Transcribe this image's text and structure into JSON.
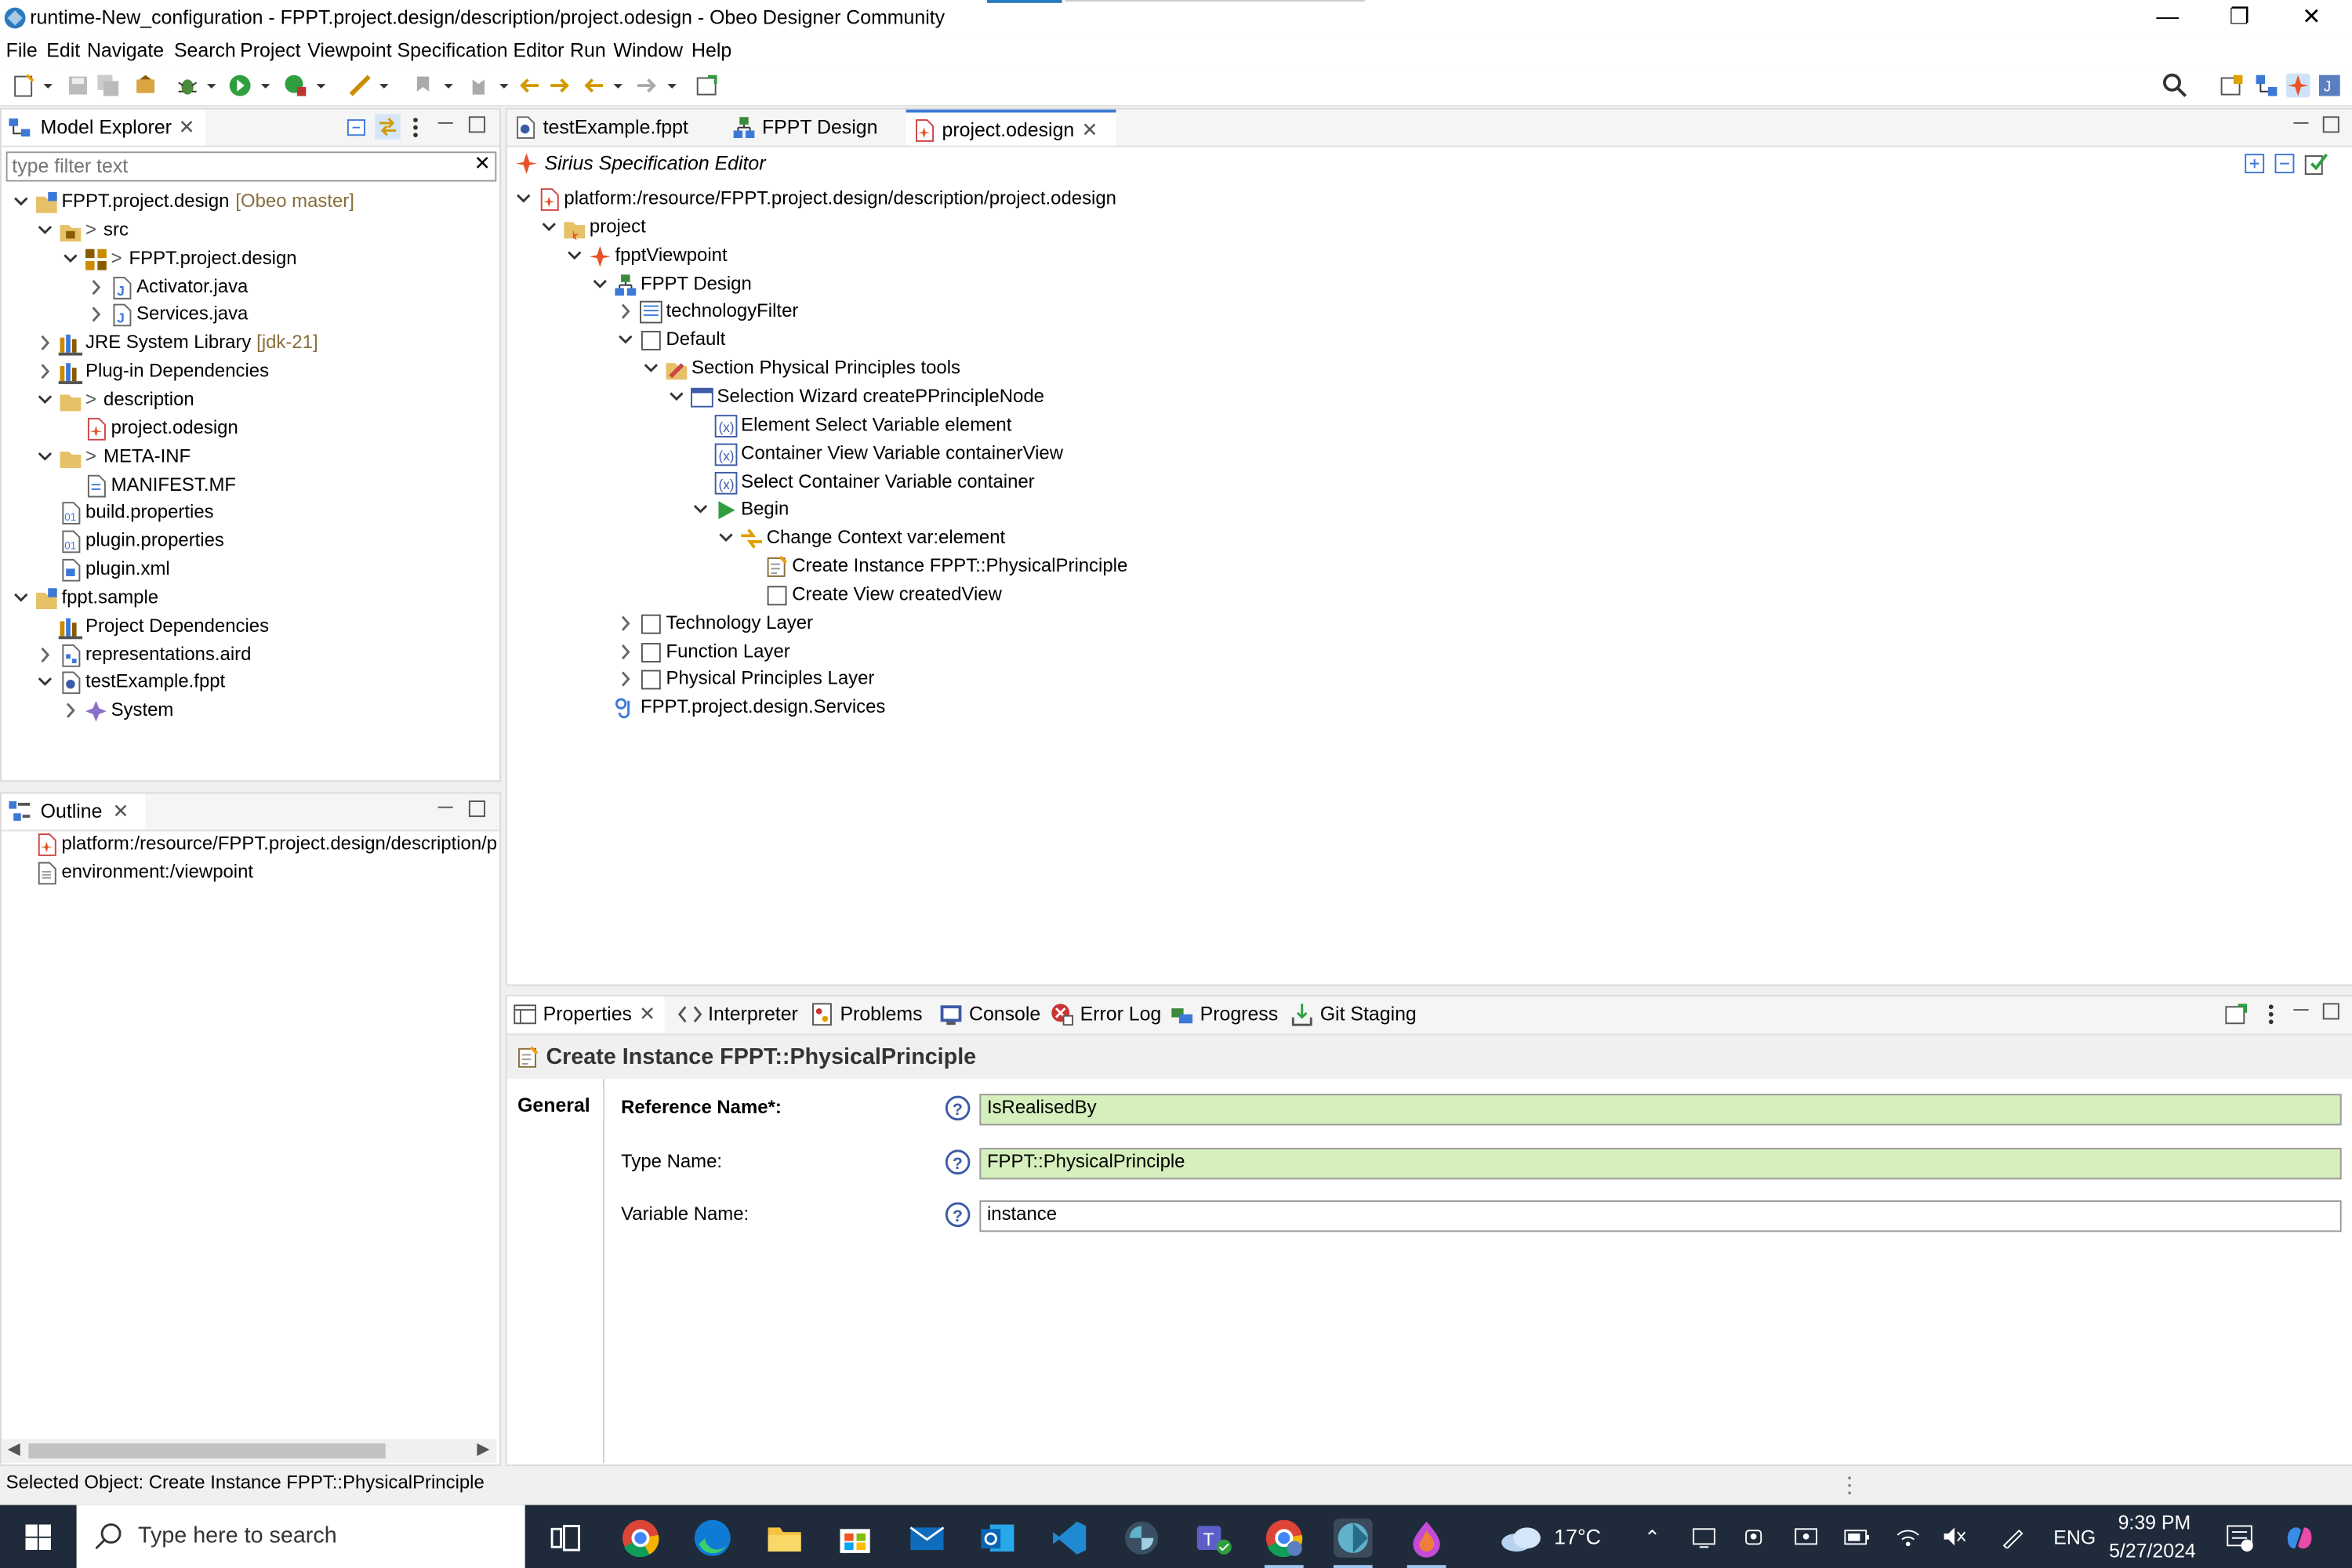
{
  "window": {
    "title": "runtime-New_configuration - FPPT.project.design/description/project.odesign - Obeo Designer Community",
    "minimize_icon": "minimize-icon",
    "restore_icon": "restore-icon",
    "close_icon": "close-icon"
  },
  "menubar": [
    "File",
    "Edit",
    "Navigate",
    "Search",
    "Project",
    "Viewpoint Specification Editor",
    "Run",
    "Window",
    "Help"
  ],
  "model_explorer": {
    "tab_label": "Model Explorer",
    "filter_placeholder": "type filter text",
    "tree": [
      {
        "label": "FPPT.project.design",
        "decoration": "[Obeo master]",
        "icon": "project-icon",
        "expanded": true
      },
      {
        "label": "src",
        "prefix": ">",
        "icon": "source-folder-icon",
        "expanded": true
      },
      {
        "label": "FPPT.project.design",
        "prefix": ">",
        "icon": "package-icon",
        "expanded": true
      },
      {
        "label": "Activator.java",
        "icon": "java-file-icon",
        "expanded": false
      },
      {
        "label": "Services.java",
        "icon": "java-file-icon",
        "expanded": false
      },
      {
        "label": "JRE System Library",
        "decoration": "[jdk-21]",
        "icon": "library-icon",
        "expanded": false
      },
      {
        "label": "Plug-in Dependencies",
        "icon": "library-icon",
        "expanded": false
      },
      {
        "label": "description",
        "prefix": ">",
        "icon": "folder-icon",
        "expanded": true
      },
      {
        "label": "project.odesign",
        "icon": "odesign-file-icon",
        "selected": true
      },
      {
        "label": "META-INF",
        "prefix": ">",
        "icon": "folder-icon",
        "expanded": true
      },
      {
        "label": "MANIFEST.MF",
        "icon": "manifest-file-icon"
      },
      {
        "label": "build.properties",
        "icon": "properties-file-icon"
      },
      {
        "label": "plugin.properties",
        "icon": "properties-file-icon"
      },
      {
        "label": "plugin.xml",
        "icon": "xml-file-icon"
      },
      {
        "label": "fppt.sample",
        "icon": "project-icon",
        "expanded": true
      },
      {
        "label": "Project Dependencies",
        "icon": "library-icon"
      },
      {
        "label": "representations.aird",
        "icon": "aird-file-icon",
        "expanded": false
      },
      {
        "label": "testExample.fppt",
        "icon": "model-file-icon",
        "expanded": true
      },
      {
        "label": "System",
        "icon": "system-element-icon",
        "expanded": false
      }
    ]
  },
  "outline": {
    "tab_label": "Outline",
    "tree": [
      {
        "label": "platform:/resource/FPPT.project.design/description/p",
        "icon": "odesign-file-icon"
      },
      {
        "label": "environment:/viewpoint",
        "icon": "document-icon"
      }
    ]
  },
  "editor": {
    "tabs": [
      {
        "label": "testExample.fppt",
        "icon": "model-file-icon"
      },
      {
        "label": "FPPT Design",
        "icon": "diagram-icon"
      },
      {
        "label": "project.odesign",
        "icon": "odesign-file-icon",
        "active": true
      }
    ],
    "header": "Sirius Specification Editor",
    "tree": [
      {
        "label": "platform:/resource/FPPT.project.design/description/project.odesign",
        "icon": "odesign-file-icon",
        "expanded": true
      },
      {
        "label": "project",
        "icon": "group-icon",
        "expanded": true
      },
      {
        "label": "fpptViewpoint",
        "icon": "viewpoint-icon",
        "expanded": true
      },
      {
        "label": "FPPT Design",
        "icon": "diagram-description-icon",
        "expanded": true
      },
      {
        "label": "technologyFilter",
        "icon": "filter-icon",
        "expanded": false
      },
      {
        "label": "Default",
        "icon": "layer-icon",
        "expanded": true
      },
      {
        "label": "Section Physical Principles tools",
        "icon": "tool-section-icon",
        "expanded": true
      },
      {
        "label": "Selection Wizard createPPrincipleNode",
        "icon": "wizard-icon",
        "expanded": true
      },
      {
        "label": "Element Select Variable element",
        "icon": "variable-icon"
      },
      {
        "label": "Container View Variable containerView",
        "icon": "variable-icon"
      },
      {
        "label": "Select Container Variable container",
        "icon": "variable-icon"
      },
      {
        "label": "Begin",
        "icon": "begin-icon",
        "expanded": true
      },
      {
        "label": "Change Context var:element",
        "icon": "change-context-icon",
        "expanded": true
      },
      {
        "label": "Create Instance FPPT::PhysicalPrinciple",
        "icon": "create-instance-icon",
        "selected": true
      },
      {
        "label": "Create View createdView",
        "icon": "create-view-icon"
      },
      {
        "label": "Technology Layer",
        "icon": "layer-icon",
        "expanded": false
      },
      {
        "label": "Function Layer",
        "icon": "layer-icon",
        "expanded": false
      },
      {
        "label": "Physical Principles Layer",
        "icon": "layer-icon",
        "expanded": false
      },
      {
        "label": "FPPT.project.design.Services",
        "icon": "java-extension-icon"
      }
    ]
  },
  "bottom_tabs": [
    {
      "label": "Properties",
      "icon": "properties-icon",
      "active": true
    },
    {
      "label": "Interpreter",
      "icon": "interpreter-icon"
    },
    {
      "label": "Problems",
      "icon": "problems-icon"
    },
    {
      "label": "Console",
      "icon": "console-icon"
    },
    {
      "label": "Error Log",
      "icon": "error-log-icon"
    },
    {
      "label": "Progress",
      "icon": "progress-icon"
    },
    {
      "label": "Git Staging",
      "icon": "git-staging-icon"
    }
  ],
  "properties": {
    "title": "Create Instance FPPT::PhysicalPrinciple",
    "section_tab": "General",
    "fields": [
      {
        "label": "Reference Name*:",
        "value": "IsRealisedBy",
        "highlight": "#d5f0bd",
        "bold": true
      },
      {
        "label": "Type Name:",
        "value": "FPPT::PhysicalPrinciple",
        "highlight": "#d5f0bd",
        "bold": false
      },
      {
        "label": "Variable Name:",
        "value": "instance",
        "highlight": "#ffffff",
        "bold": false
      }
    ]
  },
  "status": {
    "text": "Selected Object: Create Instance FPPT::PhysicalPrinciple"
  },
  "taskbar": {
    "search_placeholder": "Type here to search",
    "weather": "17°C",
    "language": "ENG",
    "time": "9:39 PM",
    "date": "5/27/2024",
    "apps": [
      "task-view-icon",
      "chrome-icon",
      "edge-icon",
      "file-explorer-icon",
      "store-icon",
      "mail-icon",
      "outlook-icon",
      "vscode-icon",
      "obeo-icon",
      "teams-icon",
      "chrome-profile-icon",
      "obeo-designer-icon",
      "paint-icon"
    ]
  },
  "colors": {
    "selection": "#d9e8fb",
    "field_highlight": "#d5f0bd",
    "taskbar": "#1f2a3a",
    "decoration": "#8a6d3b"
  }
}
